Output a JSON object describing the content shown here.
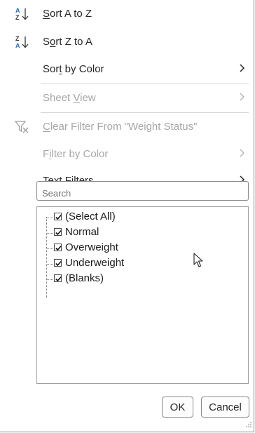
{
  "menu": {
    "sort_az": {
      "pre": "",
      "u": "S",
      "post": "ort A to Z",
      "icon": "sort-a-to-z-icon"
    },
    "sort_za": {
      "pre": "S",
      "u": "o",
      "post": "rt Z to A",
      "icon": "sort-z-to-a-icon"
    },
    "sort_by_color": {
      "pre": "Sor",
      "u": "t",
      "post": " by Color"
    },
    "sheet_view": {
      "pre": "Sheet ",
      "u": "V",
      "post": "iew"
    },
    "clear_filter": {
      "pre": "",
      "u": "C",
      "post": "lear Filter From \"Weight Status\"",
      "icon": "clear-filter-icon"
    },
    "filter_by_color": {
      "pre": "F",
      "u": "i",
      "post": "lter by Color"
    },
    "text_filters": {
      "pre": "Text ",
      "u": "F",
      "post": "ilters"
    }
  },
  "search": {
    "placeholder": "Search"
  },
  "filter_list": [
    {
      "label": "(Select All)",
      "checked": true
    },
    {
      "label": "Normal",
      "checked": true
    },
    {
      "label": "Overweight",
      "checked": true
    },
    {
      "label": "Underweight",
      "checked": true
    },
    {
      "label": "(Blanks)",
      "checked": true
    }
  ],
  "buttons": {
    "ok": "OK",
    "cancel": "Cancel"
  },
  "colors": {
    "text": "#262626",
    "disabled": "#a6a6a6",
    "sort_icon_blue": "#1e6fc9"
  }
}
